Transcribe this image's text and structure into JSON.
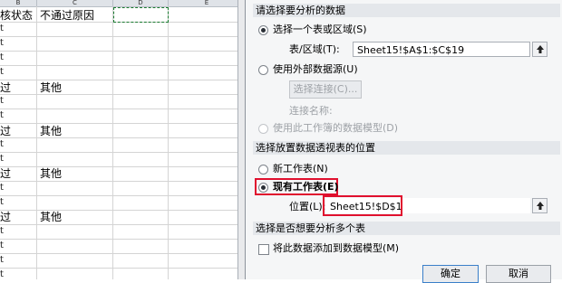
{
  "sheet": {
    "columns": [
      "B",
      "C",
      "D",
      "E"
    ],
    "header_row": {
      "b": "核状态",
      "c": "不通过原因",
      "d": ""
    },
    "rows": [
      {
        "b": "过",
        "c": "其他"
      },
      {
        "b": "过",
        "c": "其他"
      },
      {
        "b": "过",
        "c": "其他"
      },
      {
        "b": "过",
        "c": "其他"
      }
    ],
    "row_mark": "t"
  },
  "dialog": {
    "section1": "请选择要分析的数据",
    "opt_table": "选择一个表或区域(S)",
    "table_range_label": "表/区域(T):",
    "table_range_value": "Sheet15!$A$1:$C$19",
    "opt_external": "使用外部数据源(U)",
    "choose_conn_button": "选择连接(C)...",
    "conn_name_label": "连接名称:",
    "opt_data_model": "使用此工作簿的数据模型(D)",
    "section2": "选择放置数据透视表的位置",
    "opt_new_sheet": "新工作表(N)",
    "opt_existing_sheet": "现有工作表(E)",
    "location_label": "位置(L):",
    "location_value": "Sheet15!$D$1",
    "section3": "选择是否想要分析多个表",
    "add_to_model": "将此数据添加到数据模型(M)",
    "ok_button": "确定",
    "cancel_button": "取消",
    "highlight_color": "#e0102e"
  }
}
